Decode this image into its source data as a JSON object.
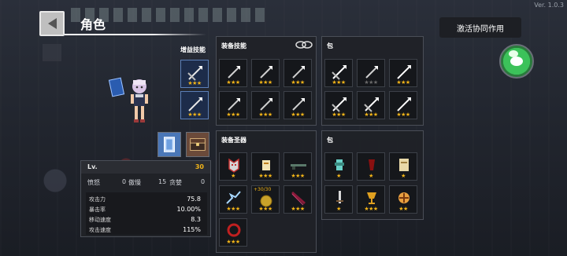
{
  "version": "Ver. 1.0.3",
  "header": {
    "title": "角色"
  },
  "synergy_button": "激活协同作用",
  "sections": {
    "extra_skills": "增益技能",
    "equipped_skills": "装备技能",
    "skill_bag": "包",
    "equipped_relics": "装备圣器",
    "relic_bag": "包",
    "relic_badge": "+30/30"
  },
  "stats": {
    "lv_label": "Lv.",
    "lv_value": "30",
    "anger_label": "愤怒",
    "anger_value": "0",
    "arrogance_label": "傲慢",
    "arrogance_value": "15",
    "greed_label": "贪婪",
    "greed_value": "0",
    "rows": [
      {
        "label": "攻击力",
        "value": "75.8"
      },
      {
        "label": "暴击率",
        "value": "10.00%"
      },
      {
        "label": "移动速度",
        "value": "8.3"
      },
      {
        "label": "攻击速度",
        "value": "115%"
      }
    ]
  },
  "icons": {
    "back": "back-arrow-icon",
    "link": "link-icon",
    "chat": "wechat-icon"
  },
  "colors": {
    "star": "#f2b418",
    "slot_blue": "#1d2c4a",
    "panel": "#202227"
  }
}
